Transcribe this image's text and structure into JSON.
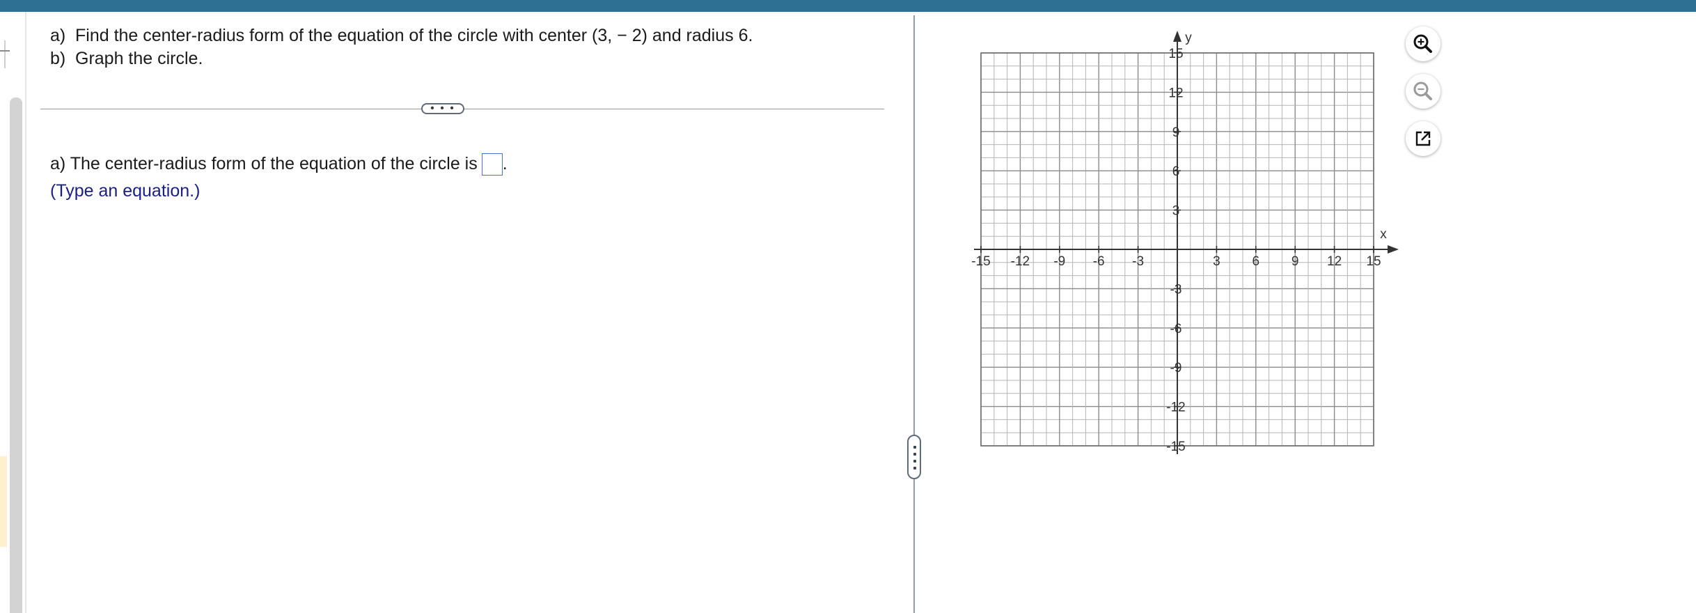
{
  "question": {
    "part_a_label": "a)",
    "part_a_text": "Find the center-radius form of the equation of the circle with center (3, − 2) and radius 6.",
    "part_b_label": "b)",
    "part_b_text": "Graph the circle."
  },
  "divider": {
    "more_label": "• • •"
  },
  "answer": {
    "prompt": "a) The center-radius form of the equation of the circle is",
    "input_value": "",
    "suffix": ".",
    "hint": "(Type an equation.)"
  },
  "graph": {
    "x_label": "x",
    "y_label": "y",
    "x_ticks": [
      "-15",
      "-12",
      "-9",
      "-6",
      "-3",
      "3",
      "6",
      "9",
      "12",
      "15"
    ],
    "y_ticks": [
      "15",
      "12",
      "9",
      "6",
      "3",
      "-3",
      "-6",
      "-9",
      "-12",
      "-15"
    ],
    "range": [
      -15,
      15
    ],
    "grid_step": 1,
    "label_step": 3
  },
  "tools": {
    "zoom_in": "zoom-in-icon",
    "zoom_out": "zoom-out-icon",
    "open_new": "open-in-new-window-icon"
  },
  "colors": {
    "top_bar": "#2e7094",
    "hint_text": "#1a1f86",
    "answer_box_border": "#4a6fd2"
  }
}
